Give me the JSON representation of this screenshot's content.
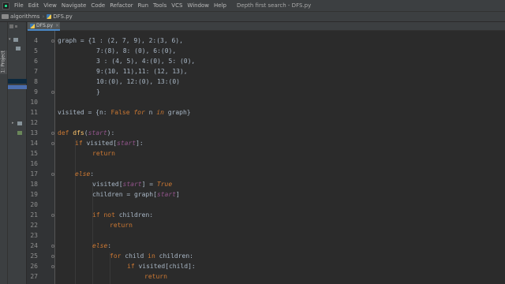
{
  "menubar": {
    "items": [
      "File",
      "Edit",
      "View",
      "Navigate",
      "Code",
      "Refactor",
      "Run",
      "Tools",
      "VCS",
      "Window",
      "Help"
    ],
    "window_title": "Depth first search - DFS.py"
  },
  "breadcrumb": {
    "project": "algorithms",
    "file": "DFS.py"
  },
  "tool_window": {
    "label": "1: Project"
  },
  "editor": {
    "active_tab": "DFS.py",
    "tab_close": "×",
    "line_numbers": [
      "4",
      "5",
      "6",
      "7",
      "8",
      "9",
      "10",
      "11",
      "12",
      "13",
      "14",
      "15",
      "16",
      "17",
      "18",
      "19",
      "20",
      "21",
      "22",
      "23",
      "24",
      "25",
      "26",
      "27"
    ],
    "code": {
      "l4": [
        "graph = {1 : (2, 7, 9), 2:(3, 6),"
      ],
      "l5": [
        "7:(8), 8: (0), 6:(0),"
      ],
      "l6": [
        "3 : (4, 5), 4:(0), 5: (0),"
      ],
      "l7": [
        "9:(10, 11),11: (12, 13),"
      ],
      "l8": [
        "10:(0), 12:(0), 13:(0)"
      ],
      "l9": [
        "}"
      ],
      "l11": [
        "visited = {n: ",
        "False",
        " ",
        "for",
        " n ",
        "in",
        " graph}"
      ],
      "l13": [
        "def",
        " ",
        "dfs",
        "(",
        "start",
        "):"
      ],
      "l14": [
        "if",
        " visited[",
        "start",
        "]:"
      ],
      "l15": [
        "return"
      ],
      "l17": [
        "else",
        ":"
      ],
      "l18": [
        "visited[",
        "start",
        "] = ",
        "True"
      ],
      "l19": [
        "children = graph[",
        "start",
        "]"
      ],
      "l21": [
        "if",
        " ",
        "not",
        " children:"
      ],
      "l22": [
        "return"
      ],
      "l24": [
        "else",
        ":"
      ],
      "l25": [
        "for",
        " child ",
        "in",
        " children:"
      ],
      "l26": [
        "if",
        " visited[child]:"
      ],
      "l27": [
        "return"
      ]
    }
  },
  "colors": {
    "background": "#2b2b2b",
    "keyword": "#cc7832",
    "function": "#ffc66d",
    "parameter": "#94558d",
    "number": "#6897bb",
    "builtin_constant": "#8888c6",
    "default_text": "#a9b7c6"
  }
}
